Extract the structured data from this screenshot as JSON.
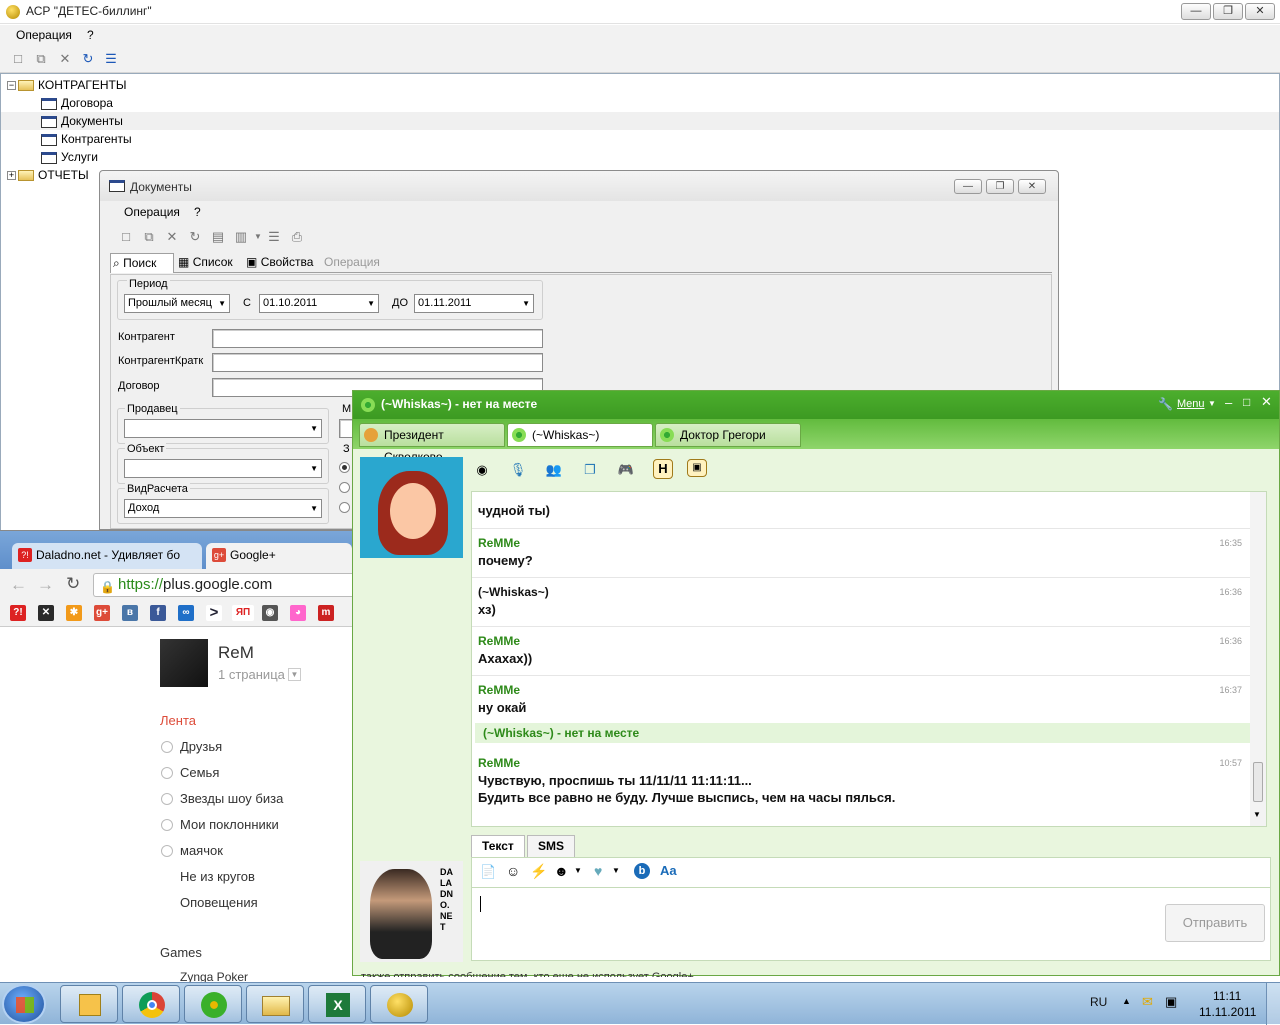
{
  "main_window": {
    "title": "АСР \"ДЕТЕС-биллинг\"",
    "menu": [
      "Операция",
      "?"
    ],
    "buttons": {
      "minimize": "—",
      "restore": "❐",
      "close": "✕"
    }
  },
  "tree": {
    "root1": "КОНТРАГЕНТЫ",
    "children": [
      "Договора",
      "Документы",
      "Контрагенты",
      "Услуги"
    ],
    "root2": "ОТЧЕТЫ"
  },
  "docs_window": {
    "title": "Документы",
    "menu": [
      "Операция",
      "?"
    ],
    "tabs": [
      "Поиск",
      "Список",
      "Свойства",
      "Операция"
    ],
    "form": {
      "period_label": "Период",
      "period_value": "Прошлый месяц",
      "from_label": "С",
      "from_value": "01.10.2011",
      "to_label": "ДО",
      "to_value": "01.11.2011",
      "kontragent_label": "Контрагент",
      "kontragent_short_label": "КонтрагентКратк",
      "dogovor_label": "Договор",
      "prodavec_label": "Продавец",
      "objekt_label": "Объект",
      "vidrascheta_label": "ВидРасчета",
      "vidrascheta_value": "Доход",
      "cut_label_m": "М",
      "cut_label_z": "З"
    }
  },
  "chrome": {
    "tabs": [
      "Daladno.net - Удивляет бо",
      "Google+"
    ],
    "url_secure": "https://",
    "url_host": "plus.google.com",
    "bookmarks_text": [
      "в",
      "ЯП",
      "m"
    ],
    "profile": {
      "name": "ReM",
      "page": "1 страница"
    },
    "nav_active": "Лента",
    "circles": [
      "Друзья",
      "Семья",
      "Звезды шоу биза",
      "Мои поклонники",
      "маячок"
    ],
    "nav_other": [
      "Не из кругов",
      "Оповещения"
    ],
    "games_title": "Games",
    "games_item": "Zynga Poker"
  },
  "icq": {
    "title": "(~Whiskas~) - нет на месте",
    "menu_label": "Menu",
    "tabs": [
      "Президент Скволково",
      "(~Whiskas~)",
      "Доктор Грегори"
    ],
    "messages": [
      {
        "nick": "",
        "time": "",
        "text": "чудной ты)"
      },
      {
        "nick": "ReMMe",
        "time": "16:35",
        "text": "почему?"
      },
      {
        "nick": "(~Whiskas~)",
        "time": "16:36",
        "text": "хз)"
      },
      {
        "nick": "ReMMe",
        "time": "16:36",
        "text": "Ахахах))"
      },
      {
        "nick": "ReMMe",
        "time": "16:37",
        "text": "ну окай"
      }
    ],
    "status_line": "(~Whiskas~) - нет на месте",
    "last_message": {
      "nick": "ReMMe",
      "time": "10:57",
      "line1": "Чувствую, проспишь ты 11/11/11 11:11:11...",
      "line2": "Будить все равно не буду. Лучше выспись, чем на часы пялься."
    },
    "input_tabs": [
      "Текст",
      "SMS"
    ],
    "send_label": "Отправить",
    "myavatar_text": "DALADNO.NET",
    "underlay_text": "также отправить сообщение тем, кто еще не использует Google+"
  },
  "taskbar": {
    "lang": "RU",
    "time": "11:11",
    "date": "11.11.2011"
  },
  "colors": {
    "icq_green": "#3c9a22",
    "gplus_red": "#dd4b39",
    "nick_green": "#2e8a1a",
    "taskbar": "#8fb4d8"
  }
}
